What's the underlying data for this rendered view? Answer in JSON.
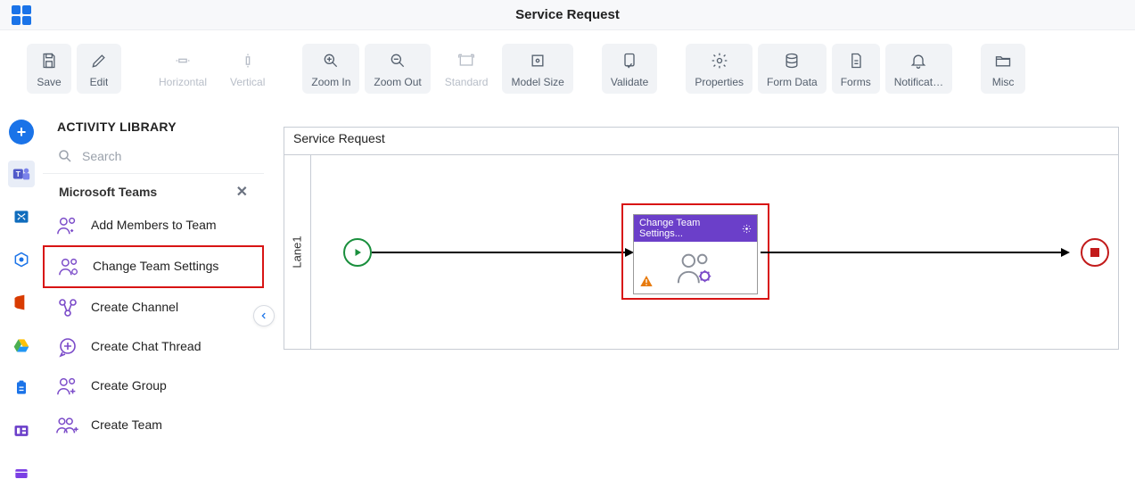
{
  "header": {
    "title": "Service Request"
  },
  "toolbar": {
    "items": [
      {
        "label": "Save",
        "icon": "save",
        "active": true
      },
      {
        "label": "Edit",
        "icon": "edit",
        "active": true
      },
      {
        "label": "Horizontal",
        "icon": "align-h",
        "disabled": true
      },
      {
        "label": "Vertical",
        "icon": "align-v",
        "disabled": true
      },
      {
        "label": "Zoom In",
        "icon": "zoom-in",
        "active": true
      },
      {
        "label": "Zoom Out",
        "icon": "zoom-out",
        "active": true
      },
      {
        "label": "Standard",
        "icon": "fit-screen",
        "disabled": true
      },
      {
        "label": "Model Size",
        "icon": "model-size",
        "active": true
      },
      {
        "label": "Validate",
        "icon": "validate",
        "active": true
      },
      {
        "label": "Properties",
        "icon": "gear",
        "active": true
      },
      {
        "label": "Form Data",
        "icon": "database",
        "active": true
      },
      {
        "label": "Forms",
        "icon": "document",
        "active": true
      },
      {
        "label": "Notificat…",
        "icon": "bell",
        "active": true
      },
      {
        "label": "Misc",
        "icon": "folder",
        "active": true
      }
    ]
  },
  "sidebar": {
    "title": "ACTIVITY LIBRARY",
    "search_placeholder": "Search",
    "group": {
      "name": "Microsoft Teams"
    },
    "items": [
      {
        "label": "Add Members to Team"
      },
      {
        "label": "Change Team Settings",
        "highlight": true
      },
      {
        "label": "Create Channel"
      },
      {
        "label": "Create Chat Thread"
      },
      {
        "label": "Create Group"
      },
      {
        "label": "Create Team"
      }
    ]
  },
  "rail": {
    "items": [
      "teams",
      "exchange",
      "sharepoint",
      "office",
      "drive",
      "clipboard",
      "layout",
      "purple"
    ]
  },
  "canvas": {
    "title": "Service Request",
    "lane": "Lane1",
    "activity": {
      "title": "Change Team Settings..."
    }
  }
}
